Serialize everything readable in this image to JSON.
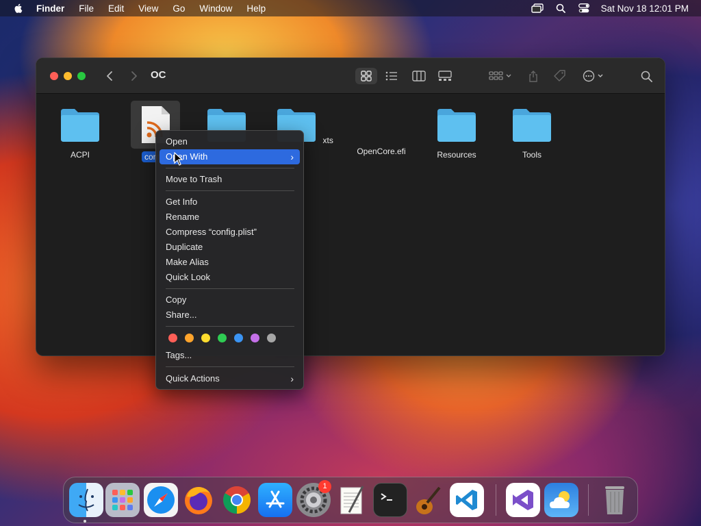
{
  "menubar": {
    "app_name": "Finder",
    "items": [
      "File",
      "Edit",
      "View",
      "Go",
      "Window",
      "Help"
    ],
    "clock": "Sat Nov 18  12:01 PM"
  },
  "window": {
    "title": "OC",
    "items": [
      {
        "label": "ACPI",
        "kind": "folder"
      },
      {
        "label": "config",
        "kind": "plist-file",
        "selected": true
      },
      {
        "label": "",
        "kind": "folder"
      },
      {
        "label": "xts",
        "kind": "folder"
      },
      {
        "label": "OpenCore.efi",
        "kind": "file"
      },
      {
        "label": "Resources",
        "kind": "folder"
      },
      {
        "label": "Tools",
        "kind": "folder"
      }
    ]
  },
  "context_menu": {
    "open": "Open",
    "open_with": "Open With",
    "move_to_trash": "Move to Trash",
    "get_info": "Get Info",
    "rename": "Rename",
    "compress": "Compress “config.plist”",
    "duplicate": "Duplicate",
    "make_alias": "Make Alias",
    "quick_look": "Quick Look",
    "copy": "Copy",
    "share": "Share...",
    "tags": "Tags...",
    "quick_actions": "Quick Actions",
    "tag_colors": [
      "#fe5f57",
      "#ffa42c",
      "#fddc2e",
      "#2fcc53",
      "#3b94f3",
      "#c470e8",
      "#a6a6a6"
    ]
  },
  "dock": {
    "settings_badge": "1",
    "apps": [
      "finder",
      "launchpad",
      "safari",
      "firefox",
      "chrome",
      "app-store",
      "system-settings",
      "textedit",
      "terminal",
      "garageband",
      "vscode",
      "visual-studio",
      "weather",
      "trash"
    ]
  }
}
